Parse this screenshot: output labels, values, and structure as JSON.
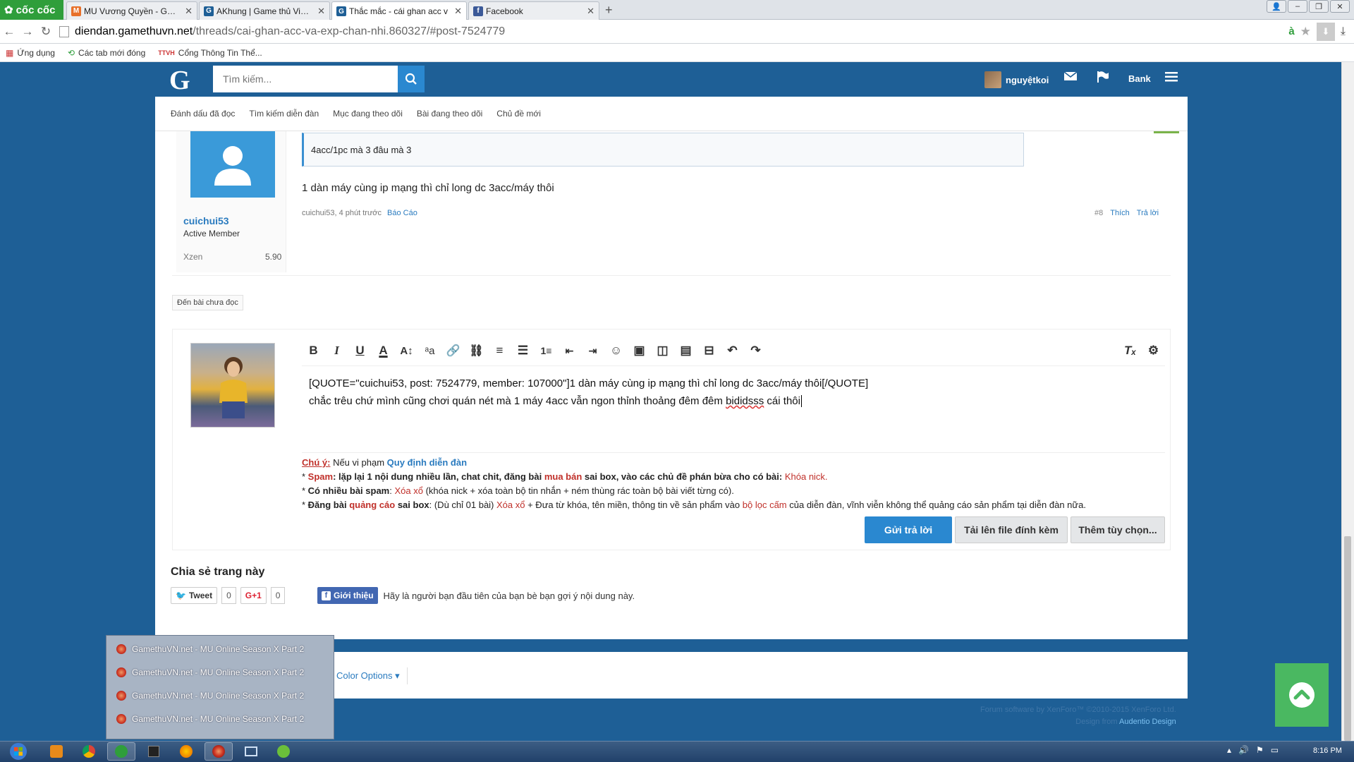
{
  "browser": {
    "brand": "cốc cốc",
    "tabs": [
      {
        "title": "MU Vương Quyền - Game"
      },
      {
        "title": "AKhung | Game thủ Việt N"
      },
      {
        "title": "Thắc mắc - cái ghan acc v"
      },
      {
        "title": "Facebook"
      }
    ],
    "url_domain": "diendan.gamethuvn.net",
    "url_path": "/threads/cai-ghan-acc-va-exp-chan-nhi.860327/#post-7524779",
    "bookmarks": [
      "Ứng dụng",
      "Các tab mới đóng",
      "Cổng Thông Tin Thể..."
    ]
  },
  "header": {
    "logo": "G",
    "search_placeholder": "Tìm kiếm...",
    "username": "nguyệtkoi",
    "bank": "Bank"
  },
  "subnav": [
    "Đánh dấu đã đọc",
    "Tìm kiếm diễn đàn",
    "Mục đang theo dõi",
    "Bài đang theo dõi",
    "Chủ đề mới"
  ],
  "post": {
    "author": "cuichui53",
    "author_title": "Active Member",
    "xzen_label": "Xzen",
    "xzen_value": "5.90",
    "quote": "4acc/1pc mà 3 đâu mà 3",
    "text": "1 dàn máy cùng ip mạng thì chỉ long dc 3acc/máy thôi",
    "meta": "cuichui53, 4 phút trước",
    "report": "Báo Cáo",
    "number": "#8",
    "like": "Thích",
    "reply": "Trả lời"
  },
  "unread_button": "Đến bài chưa đọc",
  "editor": {
    "line1": "[QUOTE=\"cuichui53, post: 7524779, member: 107000\"]1 dàn máy cùng ip mạng thì chỉ long dc 3acc/máy thôi[/QUOTE]",
    "line2_pre": "chắc trêu chứ mình cũng chơi quán nét mà 1 máy 4acc vẫn ngon thỉnh thoảng đêm đêm ",
    "line2_sq": "bididsss",
    "line2_post": " cái thôi"
  },
  "rules": {
    "note_label": "Chú ý:",
    "note_text": " Nếu vi phạm ",
    "note_link": "Quy định diễn đàn",
    "r1_a": "* ",
    "r1_b": "Spam",
    "r1_c": ": lặp lại 1 nội dung nhiều lần, chat chit, đăng bài ",
    "r1_d": "mua bán",
    "r1_e": " sai box, vào các chủ đề phán bừa cho có bài: ",
    "r1_f": "Khóa nick.",
    "r2_a": "* ",
    "r2_b": "Có nhiều bài spam",
    "r2_c": ": ",
    "r2_d": "Xóa xổ",
    "r2_e": " (khóa nick + xóa toàn bộ tin nhắn + ném thùng rác toàn bộ bài viết từng có).",
    "r3_a": "* ",
    "r3_b": "Đăng bài ",
    "r3_c": "quảng cáo",
    "r3_d": " sai box",
    "r3_e": ": (Dù chỉ 01 bài) ",
    "r3_f": "Xóa xổ",
    "r3_g": " + Đưa từ khóa, tên miền, thông tin về sản phẩm vào ",
    "r3_h": "bộ lọc cấm",
    "r3_i": " của diễn đàn, vĩnh viễn không thể quảng cáo sản phẩm tại diễn đàn nữa."
  },
  "buttons": {
    "reply": "Gửi trả lời",
    "upload": "Tải lên file đính kèm",
    "more": "Thêm tùy chọn..."
  },
  "share": {
    "title": "Chia sẻ trang này",
    "tweet": "Tweet",
    "tweet_count": "0",
    "gplus": "G+1",
    "gplus_count": "0",
    "fb_button": "Giới thiệu",
    "fb_text": "Hãy là người bạn đầu tiên của bạn bè bạn gợi ý nội dung này."
  },
  "footer": {
    "color_options": "Color Options",
    "copyright1": "Forum software by XenForo™ ©2010-2015 XenForo Ltd.",
    "copyright2_pre": "Design from ",
    "copyright2_link": "Audentio Design"
  },
  "taskbar_popup": [
    "GamethuVN.net - MU Online Season X Part 2",
    "GamethuVN.net - MU Online Season X Part 2",
    "GamethuVN.net - MU Online Season X Part 2",
    "GamethuVN.net - MU Online Season X Part 2"
  ],
  "clock": "8:16 PM"
}
